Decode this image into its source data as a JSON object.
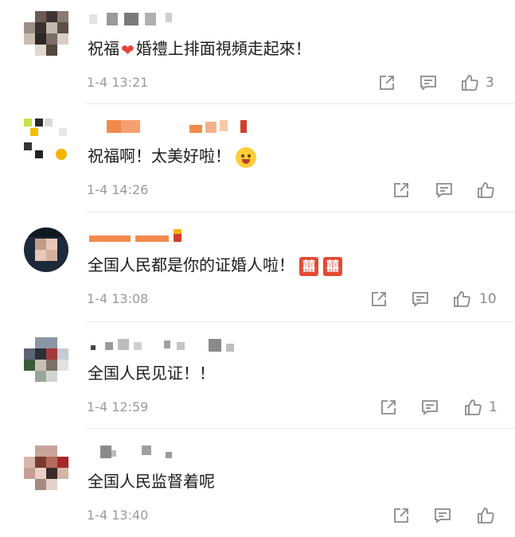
{
  "comments": [
    {
      "text_before": "祝福",
      "emoji": "heart",
      "text_after": "婚禮上排面視頻走起來！",
      "time": "1-4 13:21",
      "likes": "3"
    },
    {
      "text_before": "祝福啊！太美好啦！",
      "emoji": "excited-face",
      "text_after": "",
      "time": "1-4 14:26",
      "likes": ""
    },
    {
      "text_before": "全国人民都是你的证婚人啦！",
      "emoji": "double-happiness",
      "text_after": "",
      "time": "1-4 13:08",
      "likes": "10"
    },
    {
      "text_before": "全国人民见证！！",
      "emoji": "",
      "text_after": "",
      "time": "1-4 12:59",
      "likes": "1"
    },
    {
      "text_before": "全国人民监督着呢",
      "emoji": "",
      "text_after": "",
      "time": "1-4 13:40",
      "likes": ""
    }
  ],
  "emoji_glyphs": {
    "heart": "❤",
    "double_happiness": "囍"
  },
  "icons": [
    "share-icon",
    "comment-icon",
    "like-icon"
  ],
  "colors": {
    "text": "#1b1b1b",
    "meta": "#9a9a9a",
    "accent": "#e44a33"
  }
}
